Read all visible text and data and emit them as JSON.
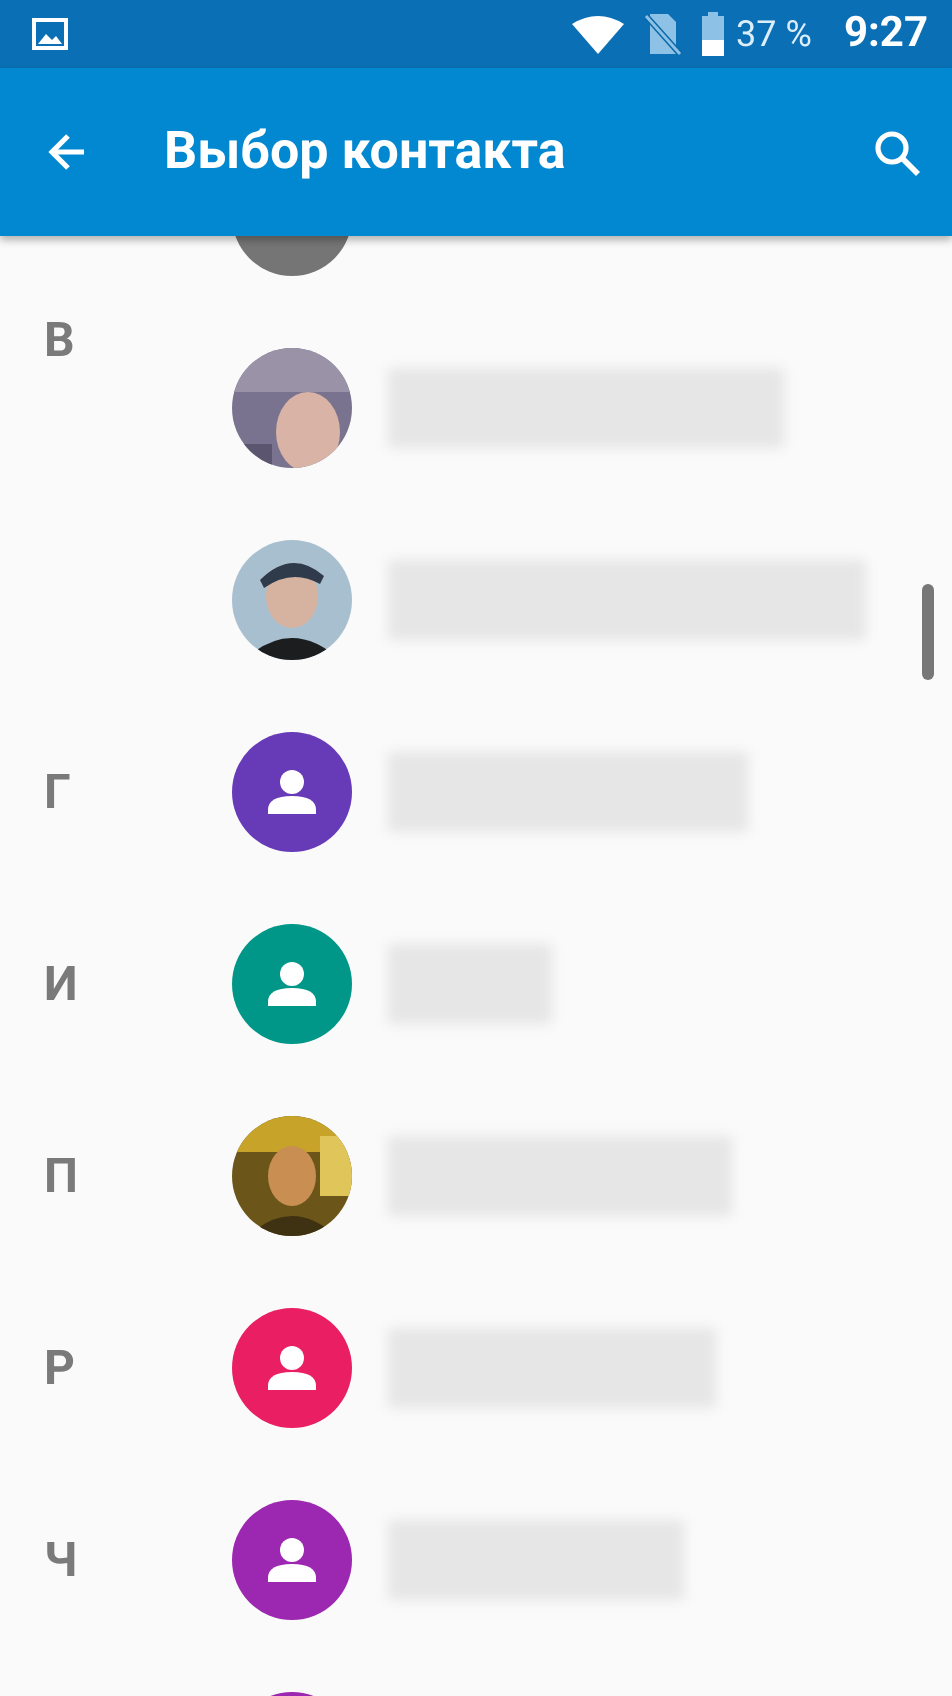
{
  "status_bar": {
    "battery": "37 %",
    "time": "9:27"
  },
  "app_bar": {
    "title": "Выбор контакта"
  },
  "contacts": [
    {
      "kind": "placeholder",
      "color": "#757575",
      "clipped": true
    },
    {
      "letter": "В",
      "pinned": true,
      "kind": "picture"
    },
    {
      "kind": "picture"
    },
    {
      "letter": "Г",
      "kind": "placeholder",
      "color": "#673ab7"
    },
    {
      "letter": "И",
      "kind": "placeholder",
      "color": "#009688"
    },
    {
      "letter": "П",
      "kind": "picture"
    },
    {
      "letter": "Р",
      "kind": "placeholder",
      "color": "#e91e63"
    },
    {
      "letter": "Ч",
      "kind": "placeholder",
      "color": "#9c27b0"
    },
    {
      "kind": "placeholder",
      "color": "#9c27b0",
      "clipped": true
    }
  ]
}
